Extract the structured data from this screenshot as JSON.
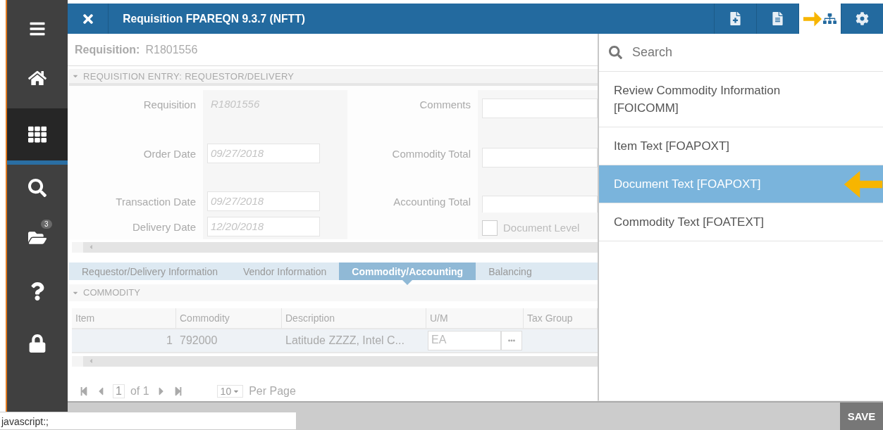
{
  "sidebar": {
    "items": [
      {
        "kind": "menu",
        "selected": false
      },
      {
        "kind": "home",
        "selected": false
      },
      {
        "kind": "apps",
        "selected": true
      },
      {
        "kind": "search",
        "selected": false
      },
      {
        "kind": "folder",
        "selected": false,
        "badge": "3"
      },
      {
        "kind": "help",
        "selected": false
      },
      {
        "kind": "lock",
        "selected": false
      }
    ]
  },
  "header": {
    "title": "Requisition FPAREQN 9.3.7 (NFTT)",
    "tools": [
      {
        "kind": "add-page",
        "selected": false
      },
      {
        "kind": "page",
        "selected": false
      },
      {
        "kind": "related",
        "selected": true
      },
      {
        "kind": "settings",
        "selected": false
      }
    ]
  },
  "key_block": {
    "label": "Requisition:",
    "value": "R1801556"
  },
  "section": {
    "title": "REQUISITION ENTRY: REQUESTOR/DELIVERY",
    "left_fields": [
      {
        "label": "Requisition",
        "value": "R1801556",
        "kind": "readonly"
      },
      {
        "label": "Order Date",
        "value": "09/27/2018",
        "kind": "input"
      },
      {
        "label": "Transaction Date",
        "value": "09/27/2018",
        "kind": "input"
      },
      {
        "label": "Delivery Date",
        "value": "12/20/2018",
        "kind": "input"
      }
    ],
    "right_fields": [
      {
        "label": "Comments",
        "kind": "input"
      },
      {
        "label": "Commodity Total",
        "kind": "input"
      },
      {
        "label": "Accounting Total",
        "kind": "input"
      },
      {
        "label": "Document Level",
        "kind": "checkbox",
        "checked": false
      }
    ]
  },
  "tabs": [
    {
      "label": "Requestor/Delivery Information",
      "selected": false
    },
    {
      "label": "Vendor Information",
      "selected": false
    },
    {
      "label": "Commodity/Accounting",
      "selected": true
    },
    {
      "label": "Balancing",
      "selected": false
    }
  ],
  "commodity": {
    "title": "COMMODITY",
    "columns": [
      "Item",
      "Commodity",
      "Description",
      "U/M",
      "Tax Group"
    ],
    "rows": [
      {
        "cells": [
          "1",
          "792000",
          "Latitude ZZZZ, Intel C...",
          "EA",
          ""
        ]
      }
    ],
    "pager": {
      "page": "1",
      "of": "of 1",
      "per_page": "10",
      "per_page_label": "Per Page"
    }
  },
  "menu": {
    "search": {
      "placeholder": "Search"
    },
    "items": [
      {
        "label": "Review Commodity Information [FOICOMM]",
        "selected": false
      },
      {
        "label": "Item Text [FOAPOXT]",
        "selected": false
      },
      {
        "label": "Document Text [FOAPOXT]",
        "selected": true
      },
      {
        "label": "Commodity Text [FOATEXT]",
        "selected": false
      }
    ]
  },
  "status_link": "javascript:;",
  "save_button": "SAVE"
}
